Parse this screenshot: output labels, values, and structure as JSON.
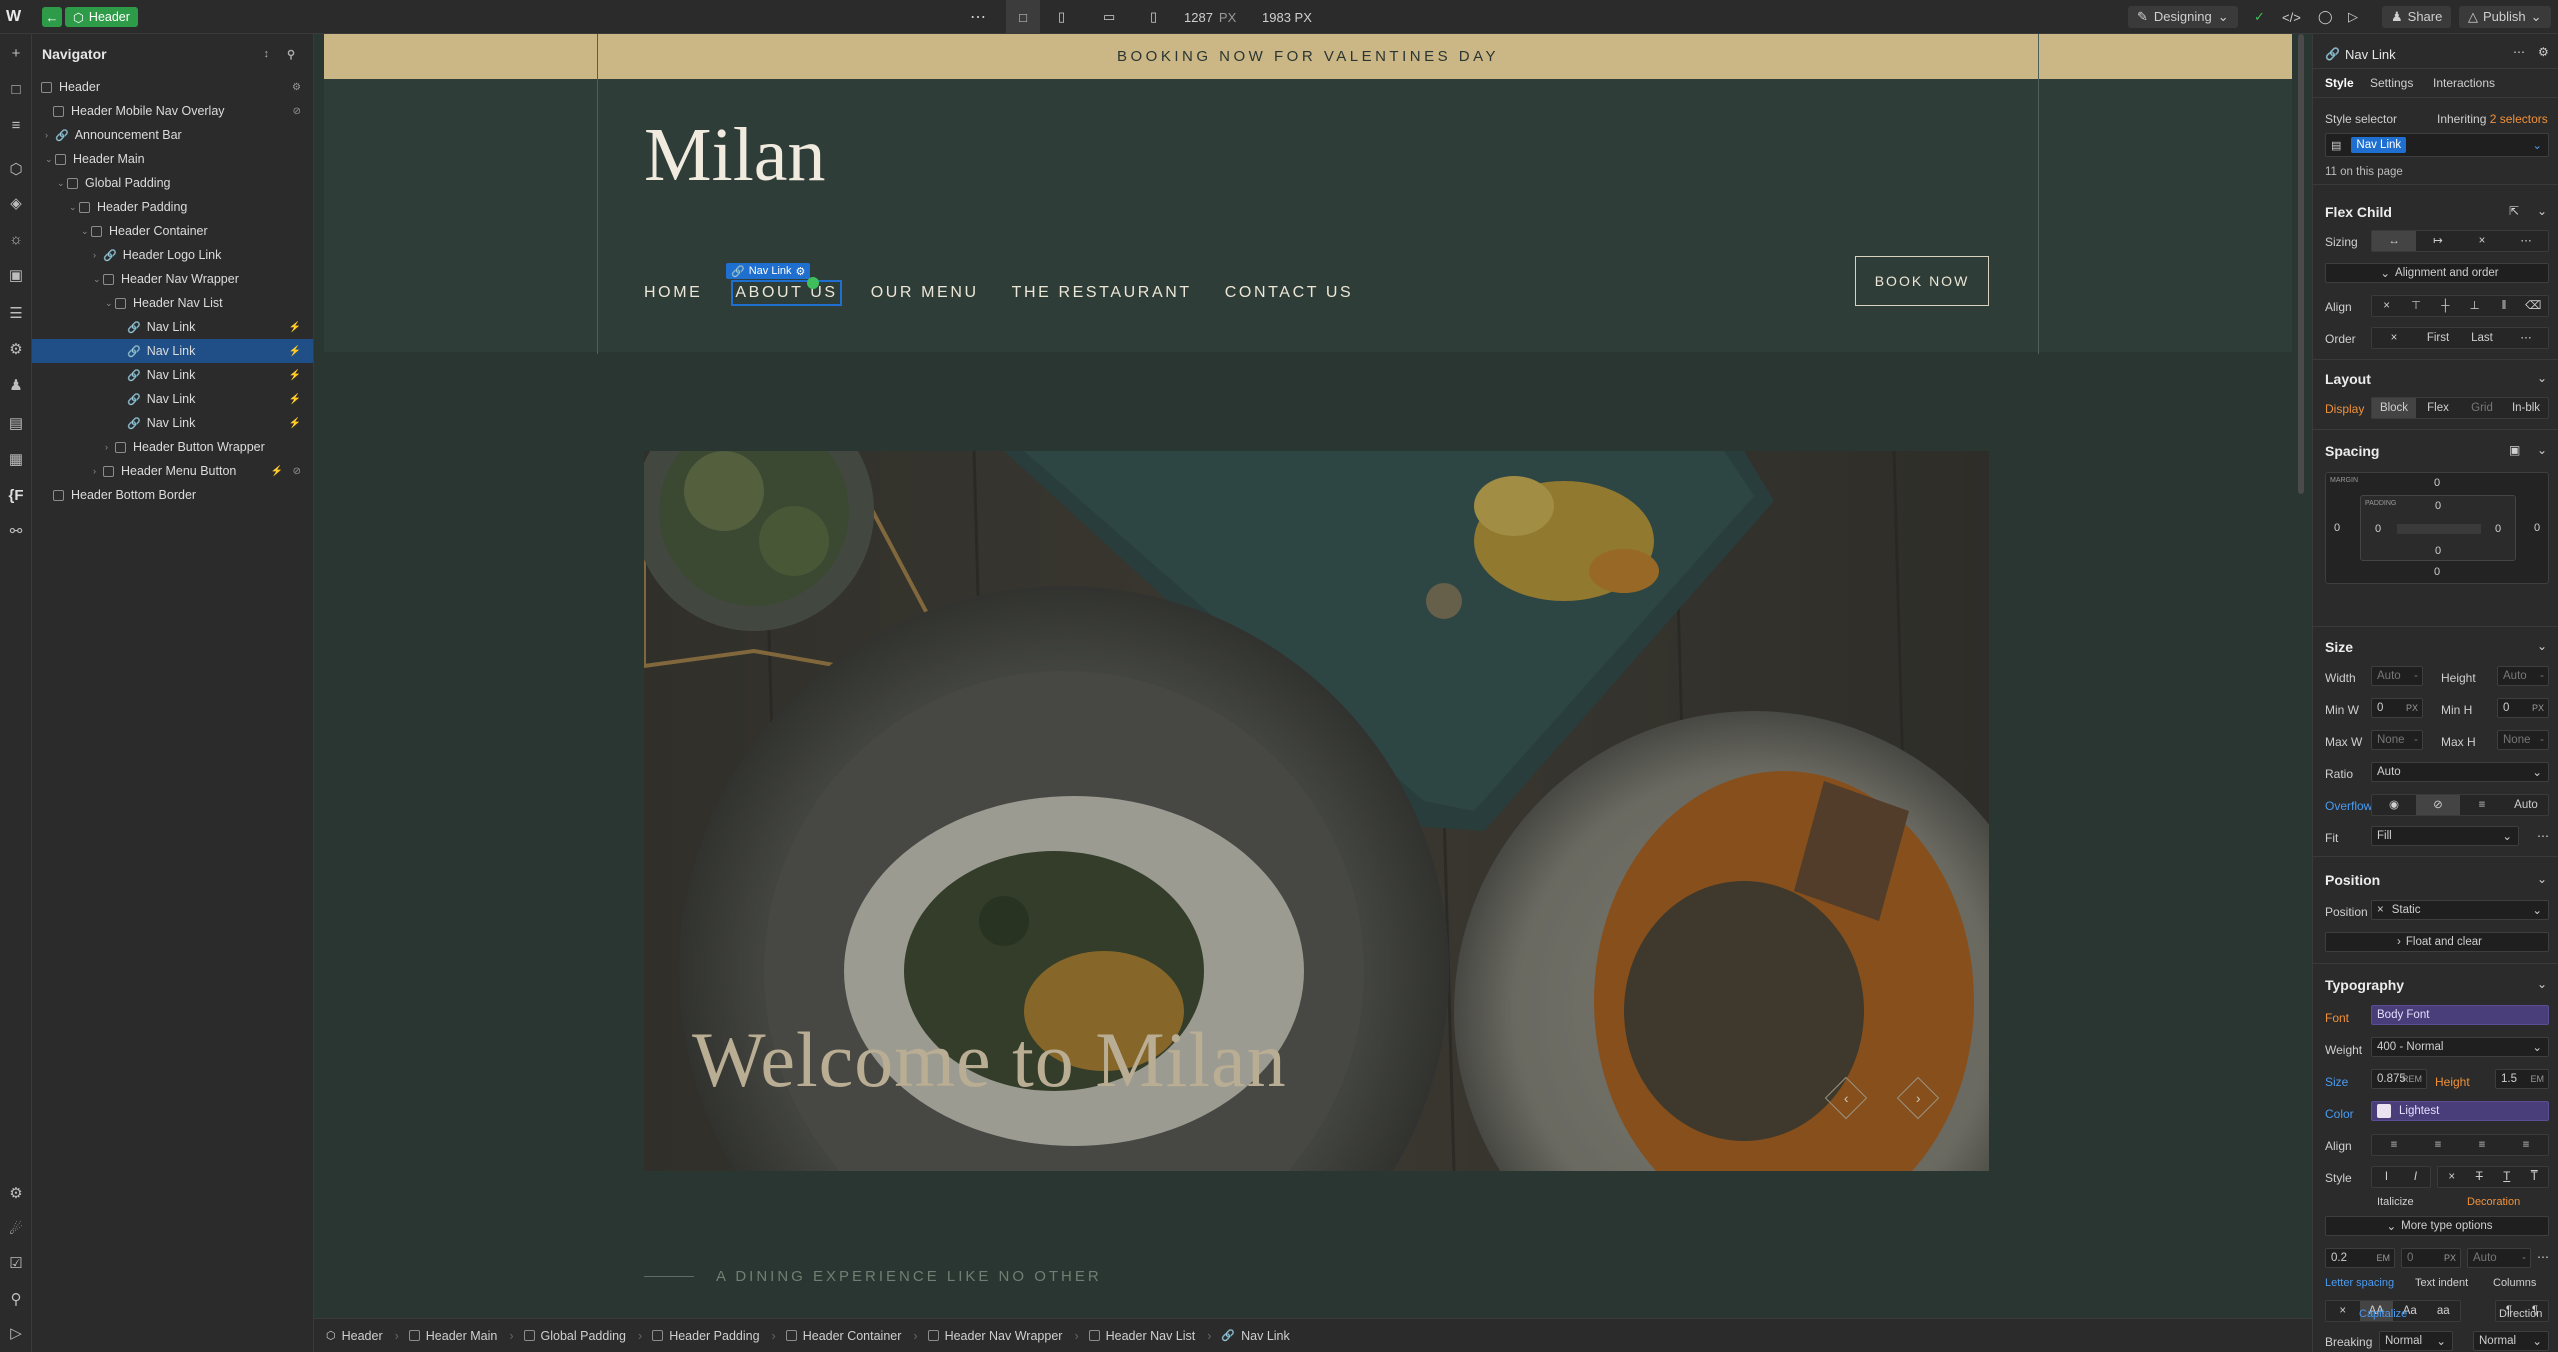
{
  "topbar": {
    "element": "Header",
    "more": "⋯",
    "width_value": "1287",
    "width_unit": "PX",
    "height_value": "1983 PX",
    "mode": "Designing",
    "share": "Share",
    "publish": "Publish"
  },
  "navigator": {
    "title": "Navigator",
    "items": [
      {
        "label": "Header"
      },
      {
        "label": "Header Mobile Nav Overlay"
      },
      {
        "label": "Announcement Bar"
      },
      {
        "label": "Header Main"
      },
      {
        "label": "Global Padding"
      },
      {
        "label": "Header Padding"
      },
      {
        "label": "Header Container"
      },
      {
        "label": "Header Logo Link"
      },
      {
        "label": "Header Nav Wrapper"
      },
      {
        "label": "Header Nav List"
      },
      {
        "label": "Nav Link"
      },
      {
        "label": "Nav Link"
      },
      {
        "label": "Nav Link"
      },
      {
        "label": "Nav Link"
      },
      {
        "label": "Nav Link"
      },
      {
        "label": "Header Button Wrapper"
      },
      {
        "label": "Header Menu Button"
      },
      {
        "label": "Header Bottom Border"
      }
    ]
  },
  "site": {
    "banner": "BOOKING NOW FOR VALENTINES DAY",
    "logo": "Milan",
    "nav": [
      "HOME",
      "ABOUT US",
      "OUR MENU",
      "THE RESTAURANT",
      "CONTACT US"
    ],
    "selection_tag": "Nav Link",
    "book": "BOOK NOW",
    "welcome": "Welcome to Milan",
    "tagline": "A DINING EXPERIENCE LIKE NO OTHER"
  },
  "breadcrumbs": [
    "Header",
    "Header Main",
    "Global Padding",
    "Header Padding",
    "Header Container",
    "Header Nav Wrapper",
    "Header Nav List",
    "Nav Link"
  ],
  "panel": {
    "title": "Nav Link",
    "tabs": [
      "Style",
      "Settings",
      "Interactions"
    ],
    "style_selector": "Style selector",
    "inheriting_prefix": "Inheriting",
    "inheriting_count": "2 selectors",
    "selector_chip": "Nav Link",
    "on_page": "11 on this page",
    "flex_child": "Flex Child",
    "sizing": "Sizing",
    "alignment_order": "Alignment and order",
    "align": "Align",
    "order": "Order",
    "order_first": "First",
    "order_last": "Last",
    "layout": "Layout",
    "display": "Display",
    "display_opts": [
      "Block",
      "Flex",
      "Grid",
      "In-blk"
    ],
    "spacing": "Spacing",
    "margin_label": "MARGIN",
    "padding_label": "PADDING",
    "zero": "0",
    "size": "Size",
    "width": "Width",
    "height": "Height",
    "auto": "Auto",
    "minw": "Min W",
    "minh": "Min H",
    "maxw": "Max W",
    "maxh": "Max H",
    "none": "None",
    "px": "PX",
    "ratio": "Ratio",
    "overflow": "Overflow",
    "fit": "Fit",
    "fit_value": "Fill",
    "position": "Position",
    "position_value": "Static",
    "float_clear": "Float and clear",
    "typography": "Typography",
    "font": "Font",
    "font_value": "Body Font",
    "weight": "Weight",
    "weight_value": "400 - Normal",
    "size_label": "Size",
    "size_value": "0.875",
    "rem": "REM",
    "line_height_label": "Height",
    "line_height_value": "1.5",
    "em": "EM",
    "color": "Color",
    "color_value": "Lightest",
    "style_label": "Style",
    "italicize": "Italicize",
    "decoration": "Decoration",
    "more_type": "More type options",
    "letter_spacing_value": "0.2",
    "letter_spacing": "Letter spacing",
    "text_indent": "Text indent",
    "columns": "Columns",
    "case_opts": [
      "AA",
      "Aa",
      "aa"
    ],
    "capitalize": "Capitalize",
    "direction": "Direction",
    "breaking": "Breaking",
    "breaking_value": "Normal",
    "breaking_value2": "Normal"
  },
  "colors": {
    "accent_blue": "#1f6fd1",
    "publish_green": "#2e9b48",
    "banner_gold": "#cbb685",
    "header_green": "#2f3d39"
  }
}
